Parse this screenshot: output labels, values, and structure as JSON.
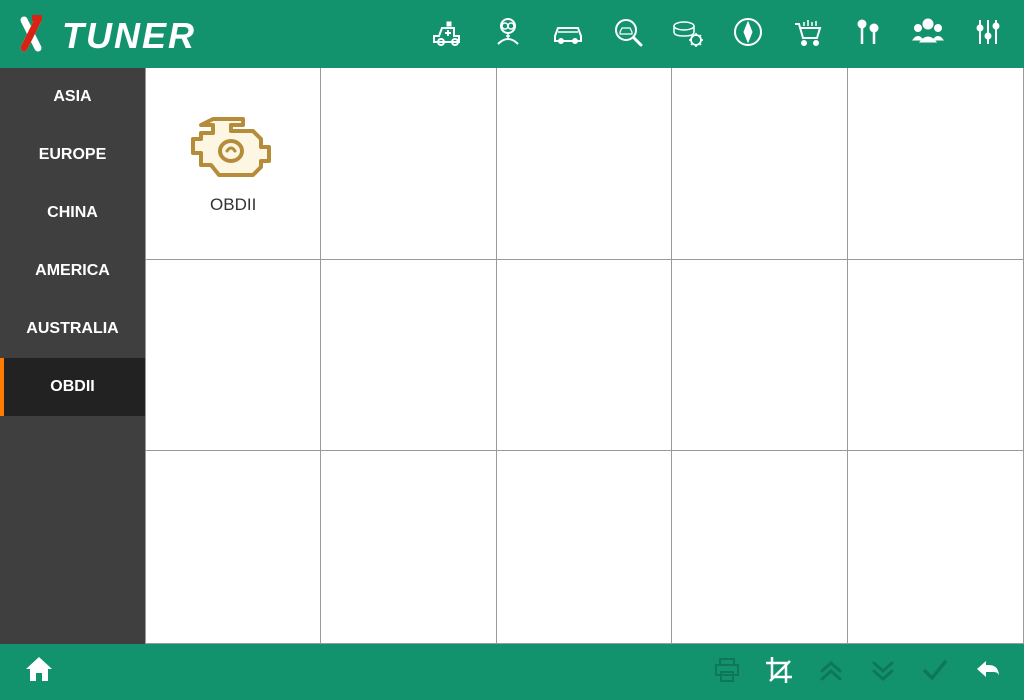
{
  "brand": "XTUNER",
  "sidebar": {
    "items": [
      {
        "label": "ASIA",
        "active": false
      },
      {
        "label": "EUROPE",
        "active": false
      },
      {
        "label": "CHINA",
        "active": false
      },
      {
        "label": "AMERICA",
        "active": false
      },
      {
        "label": "AUSTRALIA",
        "active": false
      },
      {
        "label": "OBDII",
        "active": true
      }
    ]
  },
  "grid": {
    "cells": [
      {
        "label": "OBDII",
        "icon": "engine-icon"
      },
      {},
      {},
      {},
      {},
      {},
      {},
      {},
      {},
      {},
      {},
      {},
      {},
      {},
      {}
    ]
  },
  "header_icons": [
    "ambulance-icon",
    "doctor-icon",
    "car-icon",
    "car-search-icon",
    "coin-gear-icon",
    "compass-icon",
    "cart-icon",
    "mic-icon",
    "people-icon",
    "sliders-icon"
  ],
  "footer_icons_left": [
    "home-icon"
  ],
  "footer_icons_right": [
    "print-icon",
    "crop-icon",
    "up-icon",
    "down-icon",
    "check-icon",
    "back-icon"
  ]
}
